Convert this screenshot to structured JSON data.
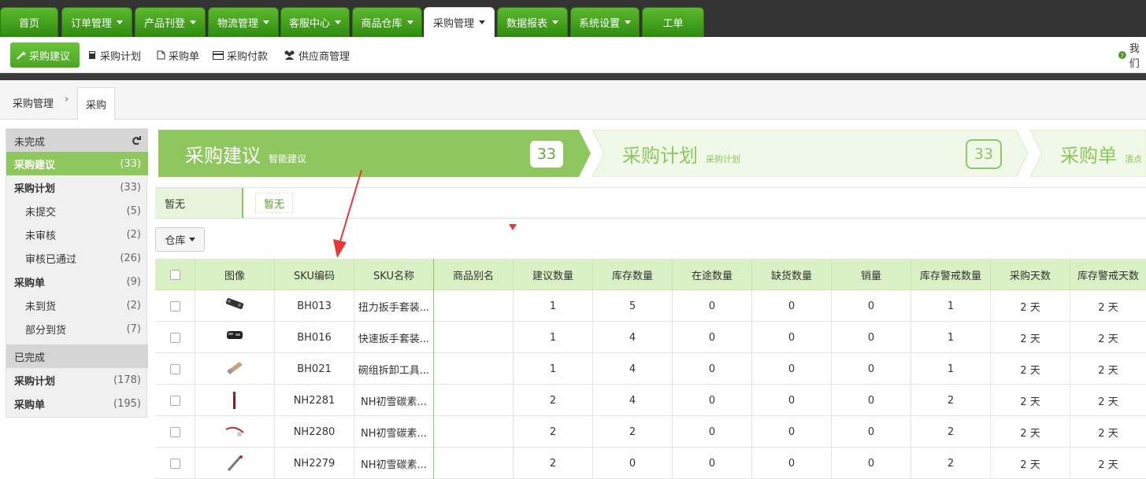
{
  "top_nav": [
    {
      "label": "首页",
      "caret": false
    },
    {
      "label": "订单管理",
      "caret": true
    },
    {
      "label": "产品刊登",
      "caret": true
    },
    {
      "label": "物流管理",
      "caret": true
    },
    {
      "label": "客服中心",
      "caret": true
    },
    {
      "label": "商品仓库",
      "caret": true
    },
    {
      "label": "采购管理",
      "caret": true,
      "active": true
    },
    {
      "label": "数据报表",
      "caret": true
    },
    {
      "label": "系统设置",
      "caret": true
    },
    {
      "label": "工单",
      "caret": false
    }
  ],
  "sub_nav": [
    {
      "label": "采购建议",
      "icon": "magic-wand-icon",
      "active": true
    },
    {
      "label": "采购计划",
      "icon": "book-icon"
    },
    {
      "label": "采购单",
      "icon": "file-icon"
    },
    {
      "label": "采购付款",
      "icon": "credit-card-icon"
    },
    {
      "label": "供应商管理",
      "icon": "users-icon"
    }
  ],
  "help_text": "我们",
  "breadcrumb": {
    "parent": "采购管理",
    "current": "采购"
  },
  "sidebar": {
    "incomplete_header": "未完成",
    "complete_header": "已完成",
    "items": [
      {
        "label": "采购建议",
        "count": "(33)",
        "style": "active"
      },
      {
        "label": "采购计划",
        "count": "(33)",
        "style": "bold"
      },
      {
        "label": "未提交",
        "count": "(5)",
        "style": "indent"
      },
      {
        "label": "未审核",
        "count": "(2)",
        "style": "indent"
      },
      {
        "label": "审核已通过",
        "count": "(26)",
        "style": "indent"
      },
      {
        "label": "采购单",
        "count": "(9)",
        "style": "bold"
      },
      {
        "label": "未到货",
        "count": "(2)",
        "style": "indent"
      },
      {
        "label": "部分到货",
        "count": "(7)",
        "style": "indent"
      }
    ],
    "done_items": [
      {
        "label": "采购计划",
        "count": "(178)"
      },
      {
        "label": "采购单",
        "count": "(195)"
      }
    ]
  },
  "steps": [
    {
      "title": "采购建议",
      "subtitle": "智能建议",
      "count": "33"
    },
    {
      "title": "采购计划",
      "subtitle": "采购计划",
      "count": "33"
    },
    {
      "title": "采购单",
      "subtitle": "清点"
    }
  ],
  "filter": {
    "label": "暂无",
    "tag": "暂无"
  },
  "warehouse_button": "仓库",
  "table": {
    "headers": [
      "图像",
      "SKU编码",
      "SKU名称",
      "商品别名",
      "建议数量",
      "库存数量",
      "在途数量",
      "缺货数量",
      "销量",
      "库存警戒数量",
      "采购天数",
      "库存警戒天数"
    ],
    "rows": [
      {
        "sku": "BH013",
        "name": "扭力扳手套装...",
        "alias": "",
        "suggest": "1",
        "stock": "5",
        "transit": "0",
        "short": "0",
        "sales": "0",
        "alert_qty": "1",
        "days": "2 天",
        "alert_days": "2 天"
      },
      {
        "sku": "BH016",
        "name": "快速扳手套装...",
        "alias": "",
        "suggest": "1",
        "stock": "4",
        "transit": "0",
        "short": "0",
        "sales": "0",
        "alert_qty": "1",
        "days": "2 天",
        "alert_days": "2 天"
      },
      {
        "sku": "BH021",
        "name": "碗组拆卸工具...",
        "alias": "",
        "suggest": "1",
        "stock": "4",
        "transit": "0",
        "short": "0",
        "sales": "0",
        "alert_qty": "1",
        "days": "2 天",
        "alert_days": "2 天"
      },
      {
        "sku": "NH2281",
        "name": "NH初雪碳素...",
        "alias": "",
        "suggest": "2",
        "stock": "4",
        "transit": "0",
        "short": "0",
        "sales": "0",
        "alert_qty": "2",
        "days": "2 天",
        "alert_days": "2 天"
      },
      {
        "sku": "NH2280",
        "name": "NH初雪碳素...",
        "alias": "",
        "suggest": "2",
        "stock": "2",
        "transit": "0",
        "short": "0",
        "sales": "0",
        "alert_qty": "2",
        "days": "2 天",
        "alert_days": "2 天"
      },
      {
        "sku": "NH2279",
        "name": "NH初雪碳素...",
        "alias": "",
        "suggest": "2",
        "stock": "0",
        "transit": "0",
        "short": "0",
        "sales": "0",
        "alert_qty": "2",
        "days": "2 天",
        "alert_days": "2 天"
      }
    ]
  },
  "colors": {
    "green": "#6cc33a",
    "dark_green": "#2f8c10",
    "light_green": "#d9f0c4",
    "arrow_red": "#e53935"
  }
}
